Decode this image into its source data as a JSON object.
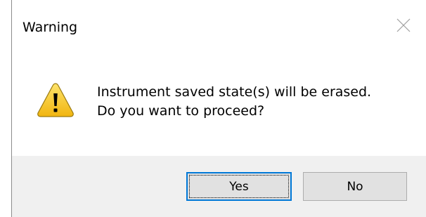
{
  "dialog": {
    "title": "Warning",
    "close_icon": "close-icon",
    "icon": "warning-icon",
    "message_line1": "Instrument saved state(s) will be erased.",
    "message_line2": "Do you want to proceed?",
    "buttons": {
      "yes_label": "Yes",
      "no_label": "No"
    },
    "colors": {
      "footer_bg": "#f0f0f0",
      "focus_border": "#0078d7",
      "warning_fill": "#f5c518"
    }
  }
}
